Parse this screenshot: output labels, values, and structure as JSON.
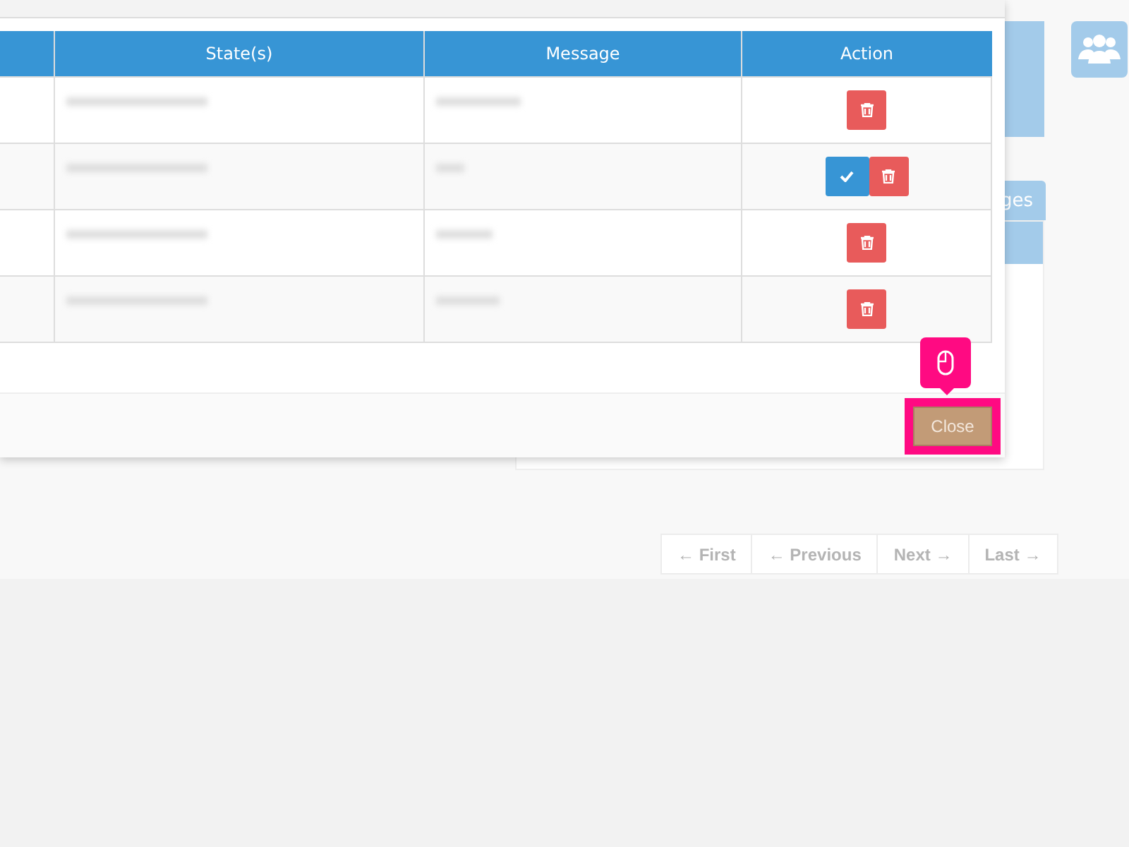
{
  "modal": {
    "table": {
      "columns": [
        "",
        "State(s)",
        "Message",
        "Action"
      ],
      "rows": [
        {
          "actions": [
            {
              "kind": "delete"
            }
          ]
        },
        {
          "actions": [
            {
              "kind": "approve"
            },
            {
              "kind": "delete"
            }
          ]
        },
        {
          "actions": [
            {
              "kind": "delete"
            }
          ]
        },
        {
          "actions": [
            {
              "kind": "delete"
            }
          ]
        }
      ]
    },
    "close_button": {
      "label": "Close",
      "highlighted": true
    }
  },
  "background": {
    "tab": "ges",
    "pagination": [
      {
        "label": "← First",
        "disabled": true
      },
      {
        "label": "← Previous",
        "disabled": true
      },
      {
        "label": "Next →",
        "disabled": true
      },
      {
        "label": "Last →",
        "disabled": true
      }
    ]
  }
}
